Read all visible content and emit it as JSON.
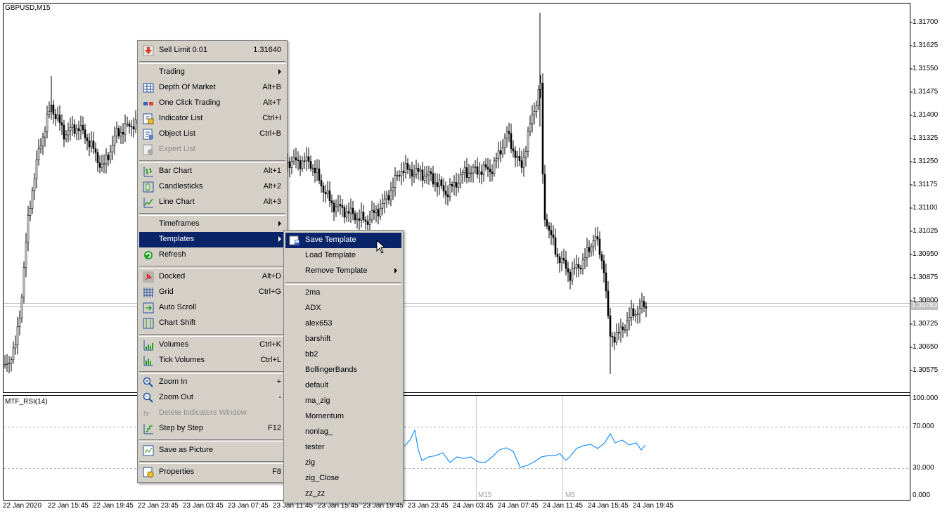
{
  "chart": {
    "symbol_title": "GBPUSD,M15",
    "indicator_title": "MTF_RSI(14)",
    "current_price": "1.30783",
    "price_axis": [
      "1.31700",
      "1.31625",
      "1.31550",
      "1.31475",
      "1.31400",
      "1.31325",
      "1.31250",
      "1.31175",
      "1.31100",
      "1.31025",
      "1.30950",
      "1.30875",
      "1.30800",
      "1.30725",
      "1.30650",
      "1.30575"
    ],
    "rsi_axis": [
      "100.000",
      "70.000",
      "30.000",
      "0.000"
    ],
    "time_axis": [
      "22 Jan 2020",
      "22 Jan 15:45",
      "22 Jan 19:45",
      "22 Jan 23:45",
      "23 Jan 03:45",
      "23 Jan 07:45",
      "23 Jan 11:45",
      "23 Jan 15:45",
      "23 Jan 19:45",
      "23 Jan 23:45",
      "24 Jan 03:45",
      "24 Jan 07:45",
      "24 Jan 11:45",
      "24 Jan 15:45",
      "24 Jan 19:45"
    ],
    "period_labels": [
      "M15",
      "M5"
    ],
    "colors": {
      "candle": "#000000",
      "rsi_line": "#1e90ff",
      "grid": "#c8c8c8"
    }
  },
  "context_menu": {
    "items": [
      {
        "label": "Sell Limit 0.01",
        "shortcut": "1.31640",
        "icon": "sell-limit-icon"
      },
      {
        "label": "Trading",
        "submenu": true
      },
      {
        "label": "Depth Of Market",
        "shortcut": "Alt+B",
        "icon": "depth-of-market-icon"
      },
      {
        "label": "One Click Trading",
        "shortcut": "Alt+T",
        "icon": "one-click-trading-icon"
      },
      {
        "label": "Indicator List",
        "shortcut": "Ctrl+I",
        "icon": "indicator-list-icon"
      },
      {
        "label": "Object List",
        "shortcut": "Ctrl+B",
        "icon": "object-list-icon"
      },
      {
        "label": "Expert List",
        "disabled": true,
        "icon": "expert-list-icon"
      },
      {
        "label": "Bar Chart",
        "shortcut": "Alt+1",
        "icon": "bar-chart-icon"
      },
      {
        "label": "Candlesticks",
        "shortcut": "Alt+2",
        "icon": "candlesticks-icon"
      },
      {
        "label": "Line Chart",
        "shortcut": "Alt+3",
        "icon": "line-chart-icon"
      },
      {
        "label": "Timeframes",
        "submenu": true
      },
      {
        "label": "Templates",
        "submenu": true,
        "highlighted": true
      },
      {
        "label": "Refresh",
        "icon": "refresh-icon"
      },
      {
        "label": "Docked",
        "shortcut": "Alt+D",
        "icon": "pin-icon"
      },
      {
        "label": "Grid",
        "shortcut": "Ctrl+G",
        "icon": "grid-icon"
      },
      {
        "label": "Auto Scroll",
        "icon": "auto-scroll-icon"
      },
      {
        "label": "Chart Shift",
        "icon": "chart-shift-icon"
      },
      {
        "label": "Volumes",
        "shortcut": "Ctrl+K",
        "icon": "volumes-icon"
      },
      {
        "label": "Tick Volumes",
        "shortcut": "Ctrl+L",
        "icon": "tick-volumes-icon"
      },
      {
        "label": "Zoom In",
        "shortcut": "+",
        "icon": "zoom-in-icon"
      },
      {
        "label": "Zoom Out",
        "shortcut": "-",
        "icon": "zoom-out-icon"
      },
      {
        "label": "Delete Indicators Window",
        "disabled": true,
        "icon": "delete-indicators-icon"
      },
      {
        "label": "Step by Step",
        "shortcut": "F12",
        "icon": "step-by-step-icon"
      },
      {
        "label": "Save as Picture",
        "icon": "save-picture-icon"
      },
      {
        "label": "Properties",
        "shortcut": "F8",
        "icon": "properties-icon"
      }
    ]
  },
  "templates_submenu": {
    "items": [
      {
        "label": "Save Template",
        "icon": "save-template-icon",
        "highlighted": true
      },
      {
        "label": "Load Template"
      },
      {
        "label": "Remove Template",
        "submenu": true
      },
      {
        "label": "2ma"
      },
      {
        "label": "ADX"
      },
      {
        "label": "alex653"
      },
      {
        "label": "barshift"
      },
      {
        "label": "bb2"
      },
      {
        "label": "BollingerBands"
      },
      {
        "label": "default"
      },
      {
        "label": "ma_zig"
      },
      {
        "label": "Momentum"
      },
      {
        "label": "nonlag_"
      },
      {
        "label": "tester"
      },
      {
        "label": "zig"
      },
      {
        "label": "zig_Close"
      },
      {
        "label": "zz_zz"
      }
    ]
  }
}
